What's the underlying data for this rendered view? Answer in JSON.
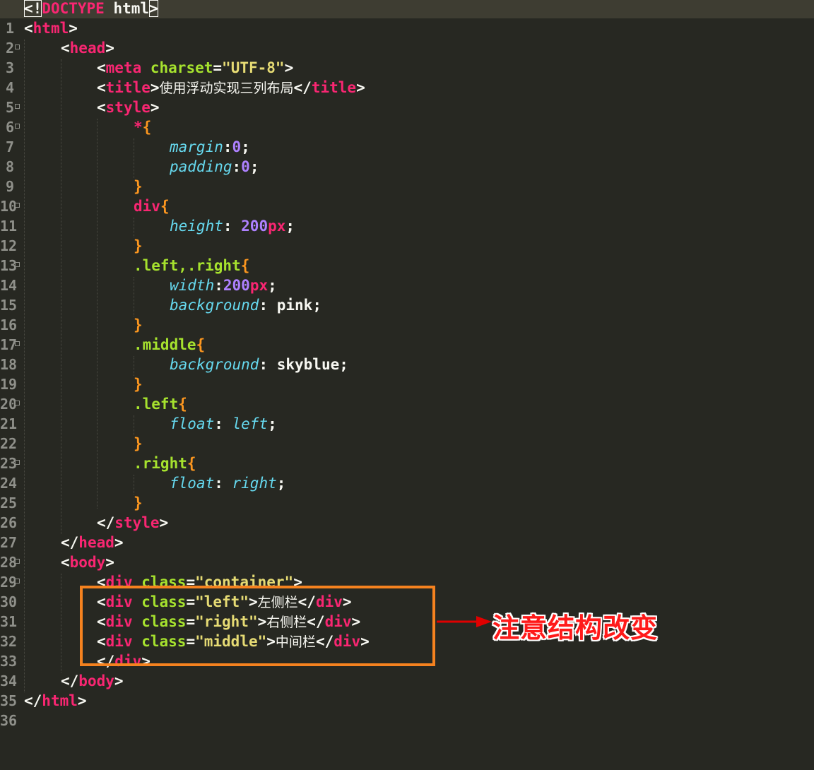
{
  "editor": {
    "line_numbers": [
      "1",
      "2",
      "3",
      "4",
      "5",
      "6",
      "7",
      "8",
      "9",
      "10",
      "11",
      "12",
      "13",
      "14",
      "15",
      "16",
      "17",
      "18",
      "19",
      "20",
      "21",
      "22",
      "23",
      "24",
      "25",
      "26",
      "27",
      "28",
      "29",
      "30",
      "31",
      "32",
      "33",
      "34",
      "35",
      "36"
    ],
    "lines": {
      "l1": {
        "open": "<!",
        "doctype": "DOCTYPE",
        "rest": " html",
        "close": ">"
      },
      "l2": {
        "open": "<",
        "tag": "html",
        "close": ">"
      },
      "l3": {
        "open": "<",
        "tag": "head",
        "close": ">"
      },
      "l4": {
        "open": "<",
        "tag": "meta",
        "attr": " charset",
        "eq": "=",
        "val": "\"UTF-8\"",
        "close": ">"
      },
      "l5": {
        "open": "<",
        "tag": "title",
        "close": ">",
        "text": "使用浮动实现三列布局",
        "open2": "</",
        "tag2": "title",
        "close2": ">"
      },
      "l6": {
        "open": "<",
        "tag": "style",
        "close": ">"
      },
      "l7": {
        "sel": "*",
        "brace": "{"
      },
      "l8": {
        "prop": "margin",
        "colon": ":",
        "num": "0",
        "semi": ";"
      },
      "l9": {
        "prop": "padding",
        "colon": ":",
        "num": "0",
        "semi": ";"
      },
      "l10": {
        "brace": "}"
      },
      "l11": {
        "sel": "div",
        "brace": "{"
      },
      "l12": {
        "prop": "height",
        "colon": ": ",
        "num": "200",
        "unit": "px",
        "semi": ";"
      },
      "l13": {
        "brace": "}"
      },
      "l14": {
        "sel": ".left,.right",
        "brace": "{"
      },
      "l15": {
        "prop": "width",
        "colon": ":",
        "num": "200",
        "unit": "px",
        "semi": ";"
      },
      "l16": {
        "prop": "background",
        "colon": ": ",
        "val": "pink",
        "semi": ";"
      },
      "l17": {
        "brace": "}"
      },
      "l18": {
        "sel": ".middle",
        "brace": "{"
      },
      "l19": {
        "prop": "background",
        "colon": ": ",
        "val": "skyblue",
        "semi": ";"
      },
      "l20": {
        "brace": "}"
      },
      "l21": {
        "sel": ".left",
        "brace": "{"
      },
      "l22": {
        "prop": "float",
        "colon": ": ",
        "val": "left",
        "semi": ";"
      },
      "l23": {
        "brace": "}"
      },
      "l24": {
        "sel": ".right",
        "brace": "{"
      },
      "l25": {
        "prop": "float",
        "colon": ": ",
        "val": "right",
        "semi": ";"
      },
      "l26": {
        "brace": "}"
      },
      "l27": {
        "open": "</",
        "tag": "style",
        "close": ">"
      },
      "l28": {
        "open": "</",
        "tag": "head",
        "close": ">"
      },
      "l29": {
        "open": "<",
        "tag": "body",
        "close": ">"
      },
      "l30": {
        "open": "<",
        "tag": "div",
        "attr": " class",
        "eq": "=",
        "val": "\"container\"",
        "close": ">"
      },
      "l31": {
        "open": "<",
        "tag": "div",
        "attr": " class",
        "eq": "=",
        "val": "\"left\"",
        "close": ">",
        "text": "左侧栏",
        "open2": "</",
        "tag2": "div",
        "close2": ">"
      },
      "l32": {
        "open": "<",
        "tag": "div",
        "attr": " class",
        "eq": "=",
        "val": "\"right\"",
        "close": ">",
        "text": "右侧栏",
        "open2": "</",
        "tag2": "div",
        "close2": ">"
      },
      "l33": {
        "open": "<",
        "tag": "div",
        "attr": " class",
        "eq": "=",
        "val": "\"middle\"",
        "close": ">",
        "text": "中间栏",
        "open2": "</",
        "tag2": "div",
        "close2": ">"
      },
      "l34": {
        "open": "</",
        "tag": "div",
        "close": ">"
      },
      "l35": {
        "open": "</",
        "tag": "body",
        "close": ">"
      },
      "l36": {
        "open": "</",
        "tag": "html",
        "close": ">"
      }
    }
  },
  "annotation": {
    "note": "注意结构改变",
    "box_color": "#f5821f",
    "arrow_color": "#e00000",
    "note_color": "#ff1a1a"
  },
  "theme": {
    "background": "#272822",
    "tag": "#f92672",
    "attribute": "#a6e22e",
    "string": "#e6db74",
    "property": "#66d9ef",
    "number": "#ae81ff",
    "brace": "#fd971f"
  }
}
